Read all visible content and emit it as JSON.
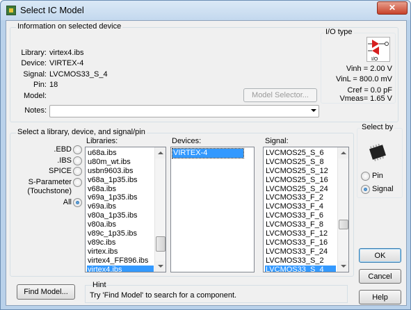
{
  "window": {
    "title": "Select IC Model",
    "close_label": "✕"
  },
  "info": {
    "group_title": "Information on selected device",
    "library_label": "Library:",
    "library_value": "virtex4.ibs",
    "device_label": "Device:",
    "device_value": "VIRTEX-4",
    "signal_label": "Signal:",
    "signal_value": "LVCMOS33_S_4",
    "pin_label": "Pin:",
    "pin_value": "18",
    "model_label": "Model:",
    "model_selector_button": "Model Selector...",
    "notes_label": "Notes:",
    "notes_value": ""
  },
  "io_type": {
    "title": "I/O type",
    "icon_text": "I/O",
    "vinh": "Vinh = 2.00 V",
    "vinl": "VinL = 800.0 mV",
    "cref": "Cref = 0.0 pF",
    "vmeas": "Vmeas= 1.65 V"
  },
  "select": {
    "group_title": "Select a library, device, and signal/pin",
    "filters": [
      {
        "label": ".EBD",
        "checked": false
      },
      {
        "label": ".IBS",
        "checked": false
      },
      {
        "label": "SPICE",
        "checked": false
      },
      {
        "label": "S-Parameter",
        "checked": false
      },
      {
        "label": "(Touchstone)",
        "checked": false
      },
      {
        "label": "All",
        "checked": true
      }
    ],
    "libraries_label": "Libraries:",
    "libraries": [
      "u68a.ibs",
      "u80m_wt.ibs",
      "usbn9603.ibs",
      "v68a_1p35.ibs",
      "v68a.ibs",
      "v69a_1p35.ibs",
      "v69a.ibs",
      "v80a_1p35.ibs",
      "v80a.ibs",
      "v89c_1p35.ibs",
      "v89c.ibs",
      "virtex.ibs",
      "virtex4_FF896.ibs",
      "virtex4.ibs"
    ],
    "devices_label": "Devices:",
    "devices": [
      "VIRTEX-4"
    ],
    "signal_label": "Signal:",
    "signals": [
      "LVCMOS25_S_6",
      "LVCMOS25_S_8",
      "LVCMOS25_S_12",
      "LVCMOS25_S_16",
      "LVCMOS25_S_24",
      "LVCMOS33_F_2",
      "LVCMOS33_F_4",
      "LVCMOS33_F_6",
      "LVCMOS33_F_8",
      "LVCMOS33_F_12",
      "LVCMOS33_F_16",
      "LVCMOS33_F_24",
      "LVCMOS33_S_2",
      "LVCMOS33_S_4"
    ]
  },
  "select_by": {
    "title": "Select by",
    "pin_label": "Pin",
    "signal_label": "Signal",
    "selected": "Signal"
  },
  "buttons": {
    "ok": "OK",
    "cancel": "Cancel",
    "help": "Help",
    "find_model": "Find Model..."
  },
  "hint": {
    "title": "Hint",
    "text": "Try 'Find Model' to search for a component."
  },
  "colors": {
    "selection": "#3399ff",
    "window_frame": "#b9d1ea",
    "dialog_bg": "#f0f0f0"
  }
}
